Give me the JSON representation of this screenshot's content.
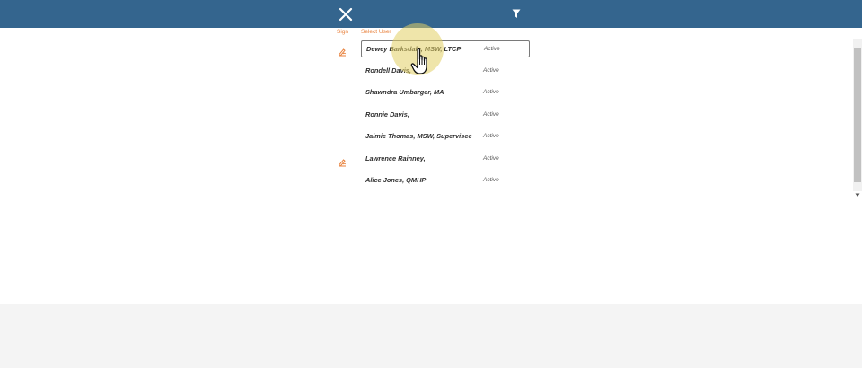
{
  "header": {
    "close_icon": "close-icon",
    "filter_icon": "filter-icon",
    "background_color": "#34658e"
  },
  "columns": {
    "sign": "Sign",
    "select_user": "Select User"
  },
  "users": [
    {
      "name": "Dewey Barksdale, MSW, LTCP",
      "status": "Active",
      "signed": true,
      "selected": true
    },
    {
      "name": "Rondell Davis,",
      "status": "Active",
      "signed": false,
      "selected": false
    },
    {
      "name": "Shawndra Umbarger, MA",
      "status": "Active",
      "signed": false,
      "selected": false
    },
    {
      "name": "Ronnie Davis,",
      "status": "Active",
      "signed": false,
      "selected": false
    },
    {
      "name": "Jaimie Thomas, MSW, Supervisee",
      "status": "Active",
      "signed": false,
      "selected": false
    },
    {
      "name": "Lawrence Rainney,",
      "status": "Active",
      "signed": true,
      "selected": false
    },
    {
      "name": "Alice Jones, QMHP",
      "status": "Active",
      "signed": false,
      "selected": false
    }
  ],
  "icons": {
    "sign_icon": "signature-icon",
    "cursor": "hand-pointer-icon"
  },
  "colors": {
    "accent": "#e8823e",
    "header": "#34658e",
    "footer": "#f4f4f4"
  }
}
